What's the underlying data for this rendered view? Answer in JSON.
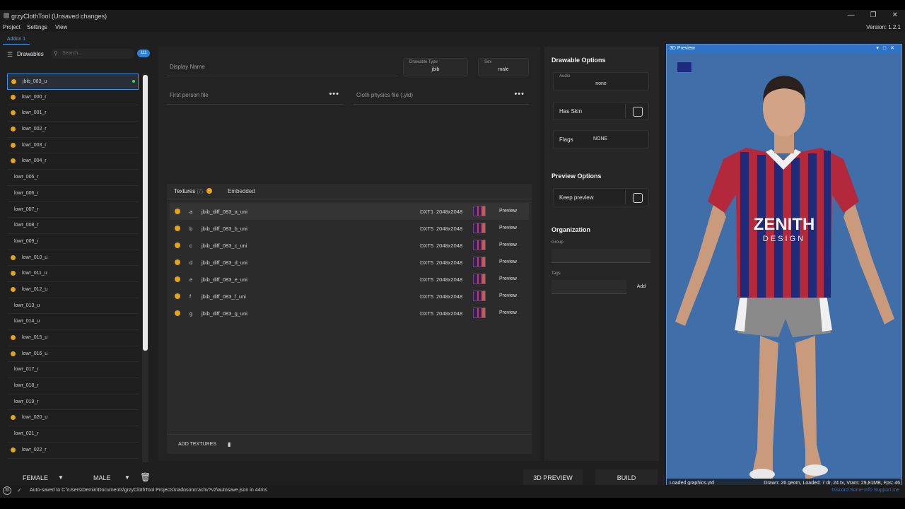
{
  "window": {
    "title": "grzyClothTool (Unsaved changes)",
    "version": "Version: 1.2.1"
  },
  "menu": [
    "Project",
    "Settings",
    "View"
  ],
  "addon_tab": "Addon 1",
  "sidebar": {
    "title": "Drawables",
    "search_placeholder": "Search...",
    "count": "111",
    "items": [
      {
        "label": "jbib_083_u",
        "warn": true,
        "selected": true
      },
      {
        "label": "lowr_000_r",
        "warn": true
      },
      {
        "label": "lowr_001_r",
        "warn": true
      },
      {
        "label": "lowr_002_r",
        "warn": true
      },
      {
        "label": "lowr_003_r",
        "warn": true
      },
      {
        "label": "lowr_004_r",
        "warn": true
      },
      {
        "label": "lowr_005_r",
        "warn": false
      },
      {
        "label": "lowr_006_r",
        "warn": false
      },
      {
        "label": "lowr_007_r",
        "warn": false
      },
      {
        "label": "lowr_008_r",
        "warn": false
      },
      {
        "label": "lowr_009_r",
        "warn": false
      },
      {
        "label": "lowr_010_u",
        "warn": true
      },
      {
        "label": "lowr_011_u",
        "warn": true
      },
      {
        "label": "lowr_012_u",
        "warn": true
      },
      {
        "label": "lowr_013_u",
        "warn": false
      },
      {
        "label": "lowr_014_u",
        "warn": false
      },
      {
        "label": "lowr_015_u",
        "warn": true
      },
      {
        "label": "lowr_016_u",
        "warn": true
      },
      {
        "label": "lowr_017_r",
        "warn": false
      },
      {
        "label": "lowr_018_r",
        "warn": false
      },
      {
        "label": "lowr_019_r",
        "warn": false
      },
      {
        "label": "lowr_020_u",
        "warn": true
      },
      {
        "label": "lowr_021_r",
        "warn": false
      },
      {
        "label": "lowr_022_r",
        "warn": true
      }
    ],
    "female_label": "FEMALE",
    "male_label": "MALE"
  },
  "details": {
    "display_name_placeholder": "Display Name",
    "drawable_type_label": "Drawable Type",
    "drawable_type_value": "jbib",
    "sex_label": "Sex",
    "sex_value": "male",
    "first_person_placeholder": "First person file",
    "cloth_physics_placeholder": "Cloth physics file (.yld)"
  },
  "textures": {
    "tab_label": "Textures",
    "tab_count": "(7)",
    "embedded_label": "Embedded",
    "rows": [
      {
        "letter": "a",
        "name": "jbib_diff_083_a_uni",
        "format": "DXT1",
        "res": "2048x2048",
        "preview": "Preview"
      },
      {
        "letter": "b",
        "name": "jbib_diff_083_b_uni",
        "format": "DXT5",
        "res": "2048x2048",
        "preview": "Preview"
      },
      {
        "letter": "c",
        "name": "jbib_diff_083_c_uni",
        "format": "DXT5",
        "res": "2048x2048",
        "preview": "Preview"
      },
      {
        "letter": "d",
        "name": "jbib_diff_083_d_uni",
        "format": "DXT5",
        "res": "2048x2048",
        "preview": "Preview"
      },
      {
        "letter": "e",
        "name": "jbib_diff_083_e_uni",
        "format": "DXT5",
        "res": "2048x2048",
        "preview": "Preview"
      },
      {
        "letter": "f",
        "name": "jbib_diff_083_f_uni",
        "format": "DXT5",
        "res": "2048x2048",
        "preview": "Preview"
      },
      {
        "letter": "g",
        "name": "jbib_diff_083_g_uni",
        "format": "DXT5",
        "res": "2048x2048",
        "preview": "Preview"
      }
    ],
    "add_label": "ADD TEXTURES"
  },
  "options": {
    "drawable_title": "Drawable Options",
    "audio_label": "Audio",
    "audio_value": "none",
    "has_skin_label": "Has Skin",
    "flags_label": "Flags",
    "flags_value": "NONE",
    "preview_title": "Preview Options",
    "keep_preview_label": "Keep preview",
    "org_title": "Organization",
    "group_label": "Group",
    "tags_label": "Tags",
    "add_label": "Add"
  },
  "preview": {
    "title": "3D Preview",
    "loaded": "Loaded graphics.ytd",
    "stats": "Drawn: 26 geom, Loaded: 7 dr, 24 tx, Vram: 29,81MB, Fps: 46",
    "shirt_text_1": "ZENITH",
    "shirt_text_2": "DESIGN",
    "colors": {
      "bg": "#3f6ea8",
      "shirt_red": "#b3283a",
      "shirt_blue": "#1d2b7a"
    }
  },
  "actions": {
    "preview_button": "3D PREVIEW",
    "build_button": "BUILD"
  },
  "status": {
    "message": "Auto-saved to C:\\Users\\Demin\\Documents\\grzyClothTool Projects\\nadosoncrachv?v2\\autosave.json in 44ms",
    "links": "Discord   Some Info   Support me"
  }
}
